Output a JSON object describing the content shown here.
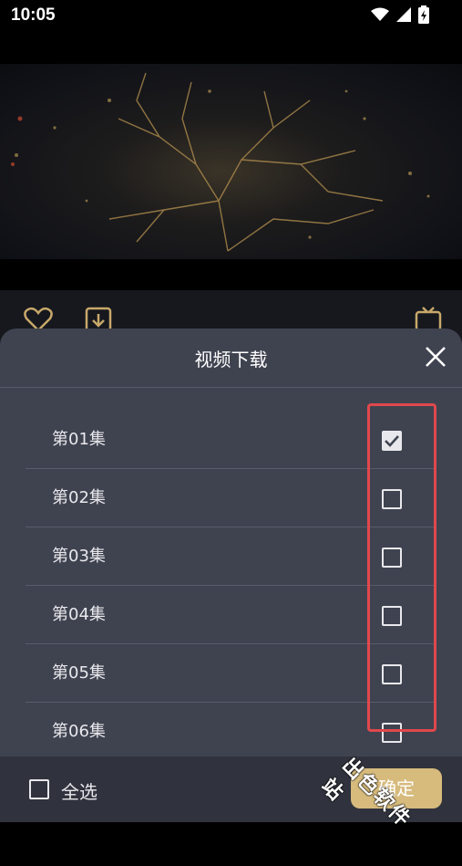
{
  "status_bar": {
    "time": "10:05",
    "icons": [
      "wifi-icon",
      "signal-icon",
      "battery-charging-icon"
    ]
  },
  "sheet": {
    "title": "视频下载",
    "episodes": [
      {
        "label": "第01集",
        "checked": true
      },
      {
        "label": "第02集",
        "checked": false
      },
      {
        "label": "第03集",
        "checked": false
      },
      {
        "label": "第04集",
        "checked": false
      },
      {
        "label": "第05集",
        "checked": false
      },
      {
        "label": "第06集",
        "checked": false
      }
    ]
  },
  "bottom_bar": {
    "select_all_label": "全选",
    "confirm_label": "确定"
  },
  "watermark": "出色软件站",
  "colors": {
    "accent": "#d7bb7d",
    "sheet_bg": "#3f4350",
    "highlight": "#e0484c"
  }
}
